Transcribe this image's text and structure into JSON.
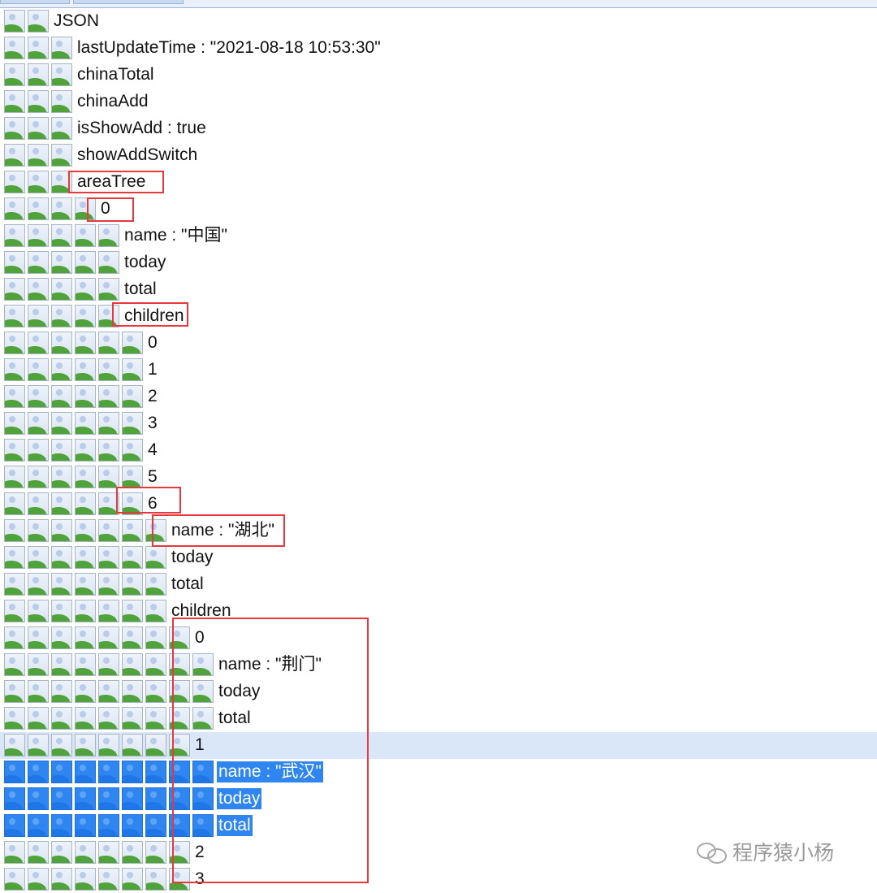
{
  "tree": {
    "rows": [
      {
        "label": "JSON",
        "depth": 2
      },
      {
        "label": "lastUpdateTime : \"2021-08-18 10:53:30\"",
        "depth": 3
      },
      {
        "label": "chinaTotal",
        "depth": 3
      },
      {
        "label": "chinaAdd",
        "depth": 3
      },
      {
        "label": "isShowAdd : true",
        "depth": 3
      },
      {
        "label": "showAddSwitch",
        "depth": 3
      },
      {
        "label": "areaTree",
        "depth": 3
      },
      {
        "label": "0",
        "depth": 4
      },
      {
        "label": "name : \"中国\"",
        "depth": 5
      },
      {
        "label": "today",
        "depth": 5
      },
      {
        "label": "total",
        "depth": 5
      },
      {
        "label": "children",
        "depth": 5
      },
      {
        "label": "0",
        "depth": 6
      },
      {
        "label": "1",
        "depth": 6
      },
      {
        "label": "2",
        "depth": 6
      },
      {
        "label": "3",
        "depth": 6
      },
      {
        "label": "4",
        "depth": 6
      },
      {
        "label": "5",
        "depth": 6
      },
      {
        "label": "6",
        "depth": 6
      },
      {
        "label": "name : \"湖北\"",
        "depth": 7
      },
      {
        "label": "today",
        "depth": 7
      },
      {
        "label": "total",
        "depth": 7
      },
      {
        "label": "children",
        "depth": 7
      },
      {
        "label": "0",
        "depth": 8
      },
      {
        "label": "name : \"荆门\"",
        "depth": 9
      },
      {
        "label": "today",
        "depth": 9
      },
      {
        "label": "total",
        "depth": 9
      },
      {
        "label": "1",
        "depth": 8,
        "state": "hover"
      },
      {
        "label": "name : \"武汉\"",
        "depth": 9,
        "state": "selected"
      },
      {
        "label": "today",
        "depth": 9,
        "state": "selected"
      },
      {
        "label": "total",
        "depth": 9,
        "state": "selected"
      },
      {
        "label": "2",
        "depth": 8
      },
      {
        "label": "3",
        "depth": 8
      }
    ]
  },
  "icons": {
    "node": "image-placeholder-icon"
  },
  "colors": {
    "highlight_box": "#e8383d",
    "selection": "#2f86f0",
    "hover_row": "#d9e7f8"
  },
  "watermark": {
    "text": "程序猿小杨"
  }
}
